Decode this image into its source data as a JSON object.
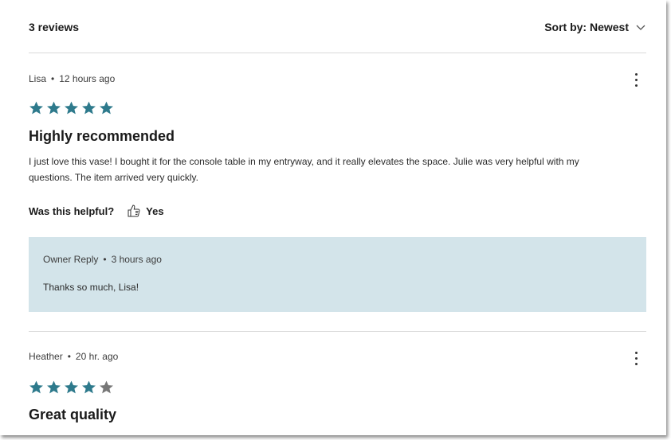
{
  "colors": {
    "star_filled": "#2e7a8c",
    "star_empty": "#777777",
    "reply_bg": "#d3e4ea",
    "divider": "#d9d9d9"
  },
  "header": {
    "review_count": "3 reviews",
    "sort_label": "Sort by: Newest"
  },
  "separator": "•",
  "reviews": [
    {
      "author": "Lisa",
      "time": "12 hours ago",
      "rating": 5,
      "max_rating": 5,
      "title": "Highly recommended",
      "body": "I just love this vase! I bought it for the console table in my entryway, and it really elevates the space. Julie was very helpful with my questions. The item arrived very quickly.",
      "helpful_prompt": "Was this helpful?",
      "helpful_yes": "Yes",
      "reply": {
        "author": "Owner Reply",
        "time": "3 hours ago",
        "text": "Thanks so much, Lisa!"
      }
    },
    {
      "author": "Heather",
      "time": "20 hr. ago",
      "rating": 4,
      "max_rating": 5,
      "title": "Great quality"
    }
  ]
}
